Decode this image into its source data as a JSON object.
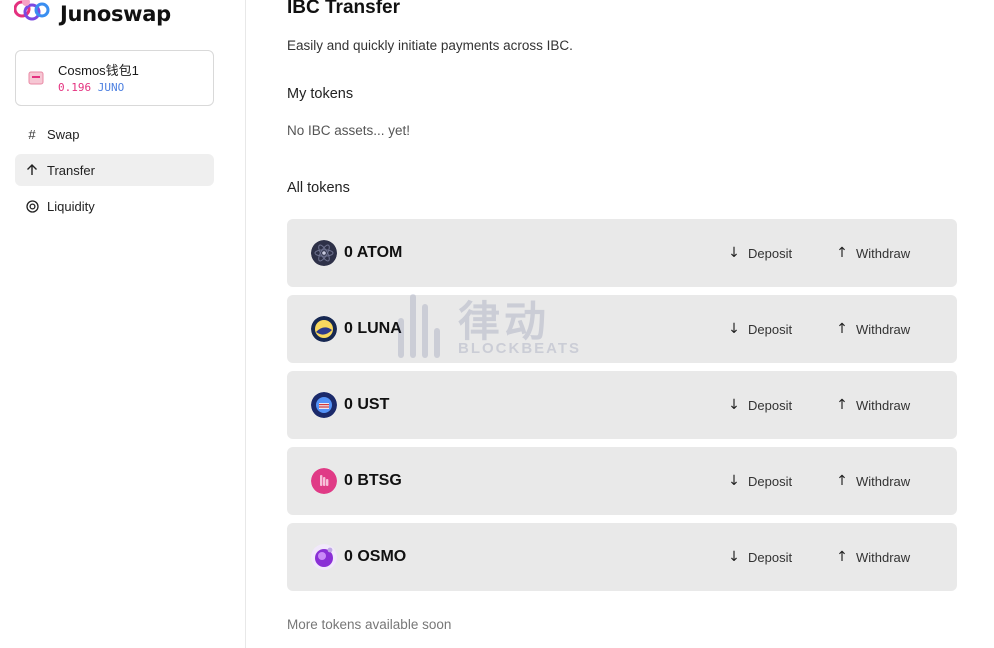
{
  "app": {
    "logo_text": "Junoswap"
  },
  "wallet": {
    "name": "Cosmos钱包1",
    "balance_amount": "0.196",
    "balance_unit": "JUNO"
  },
  "sidebar": {
    "items": [
      {
        "label": "Swap",
        "icon": "hash-icon",
        "active": false
      },
      {
        "label": "Transfer",
        "icon": "arrow-up-icon",
        "active": true
      },
      {
        "label": "Liquidity",
        "icon": "target-icon",
        "active": false
      }
    ]
  },
  "main": {
    "title": "IBC Transfer",
    "subtitle": "Easily and quickly initiate payments across IBC.",
    "my_tokens_heading": "My tokens",
    "my_tokens_empty": "No IBC assets... yet!",
    "all_tokens_heading": "All tokens",
    "deposit_label": "Deposit",
    "withdraw_label": "Withdraw",
    "tokens": [
      {
        "label": "0 ATOM",
        "icon": "atom-logo-icon"
      },
      {
        "label": "0 LUNA",
        "icon": "luna-logo-icon"
      },
      {
        "label": "0 UST",
        "icon": "ust-logo-icon"
      },
      {
        "label": "0 BTSG",
        "icon": "btsg-logo-icon"
      },
      {
        "label": "0 OSMO",
        "icon": "osmo-logo-icon"
      }
    ],
    "footer_note": "More tokens available soon"
  },
  "watermark": {
    "cn": "律动",
    "en": "BLOCKBEATS"
  },
  "colors": {
    "accent_pink": "#e4317f",
    "accent_blue": "#4c7fe0",
    "row_bg": "#e9e9e9"
  }
}
